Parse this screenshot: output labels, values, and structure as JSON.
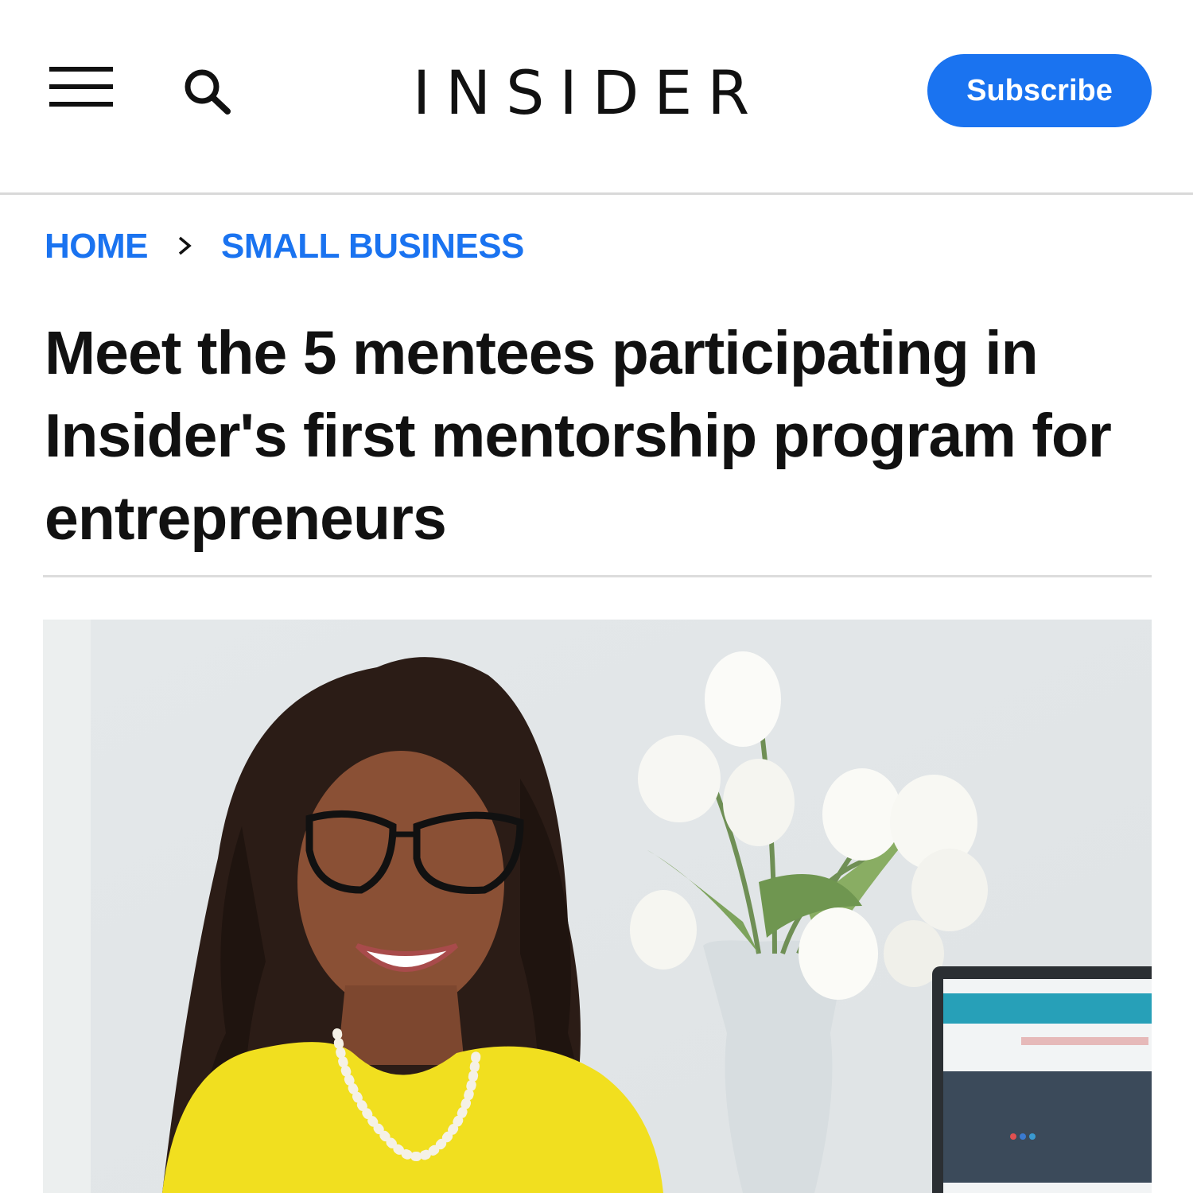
{
  "header": {
    "menu_icon": "hamburger-menu-icon",
    "search_icon": "search-icon",
    "logo_text": "INSIDER",
    "subscribe_label": "Subscribe"
  },
  "breadcrumb": {
    "home": "HOME",
    "separator": "›",
    "section": "SMALL BUSINESS"
  },
  "article": {
    "headline": "Meet the 5 mentees participating in Insider's first mentorship program for entrepreneurs"
  },
  "colors": {
    "accent": "#1a73f0",
    "text": "#111111",
    "divider": "#d9d9d9"
  }
}
